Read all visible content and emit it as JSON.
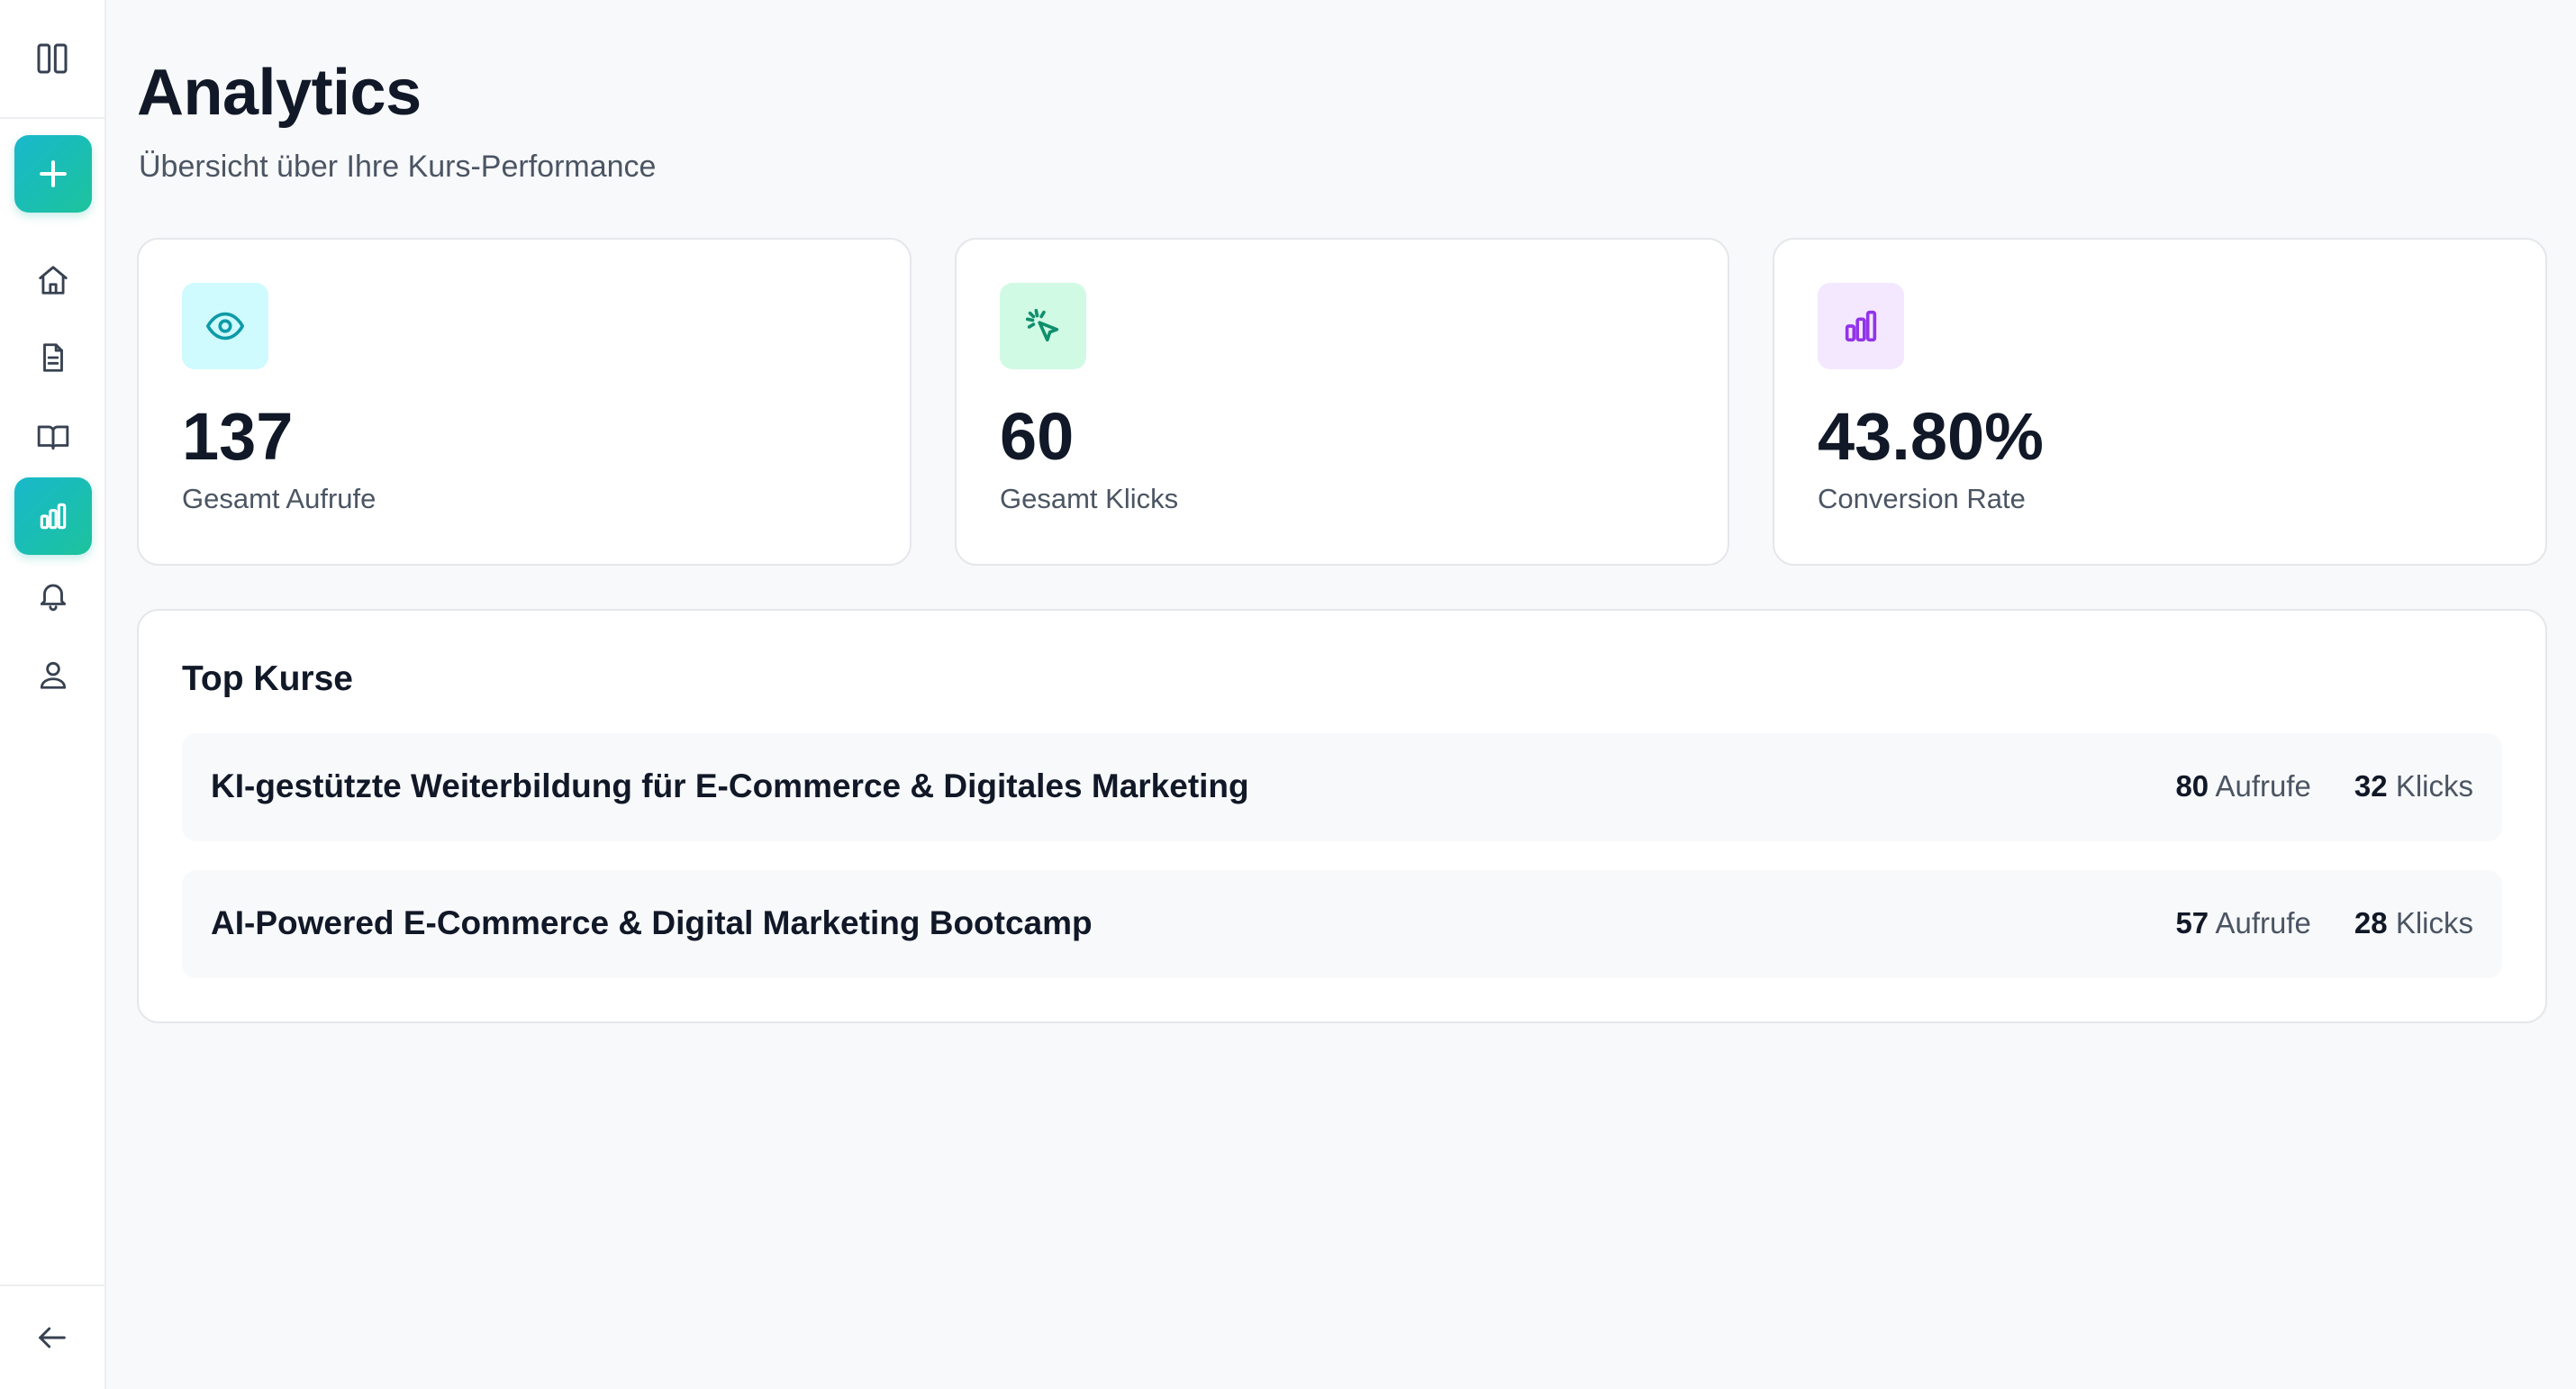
{
  "page": {
    "title": "Analytics",
    "subtitle": "Übersicht über Ihre Kurs-Performance"
  },
  "sidebar": {
    "top_icon": "panel-columns-icon",
    "items": [
      {
        "icon": "plus-icon",
        "active": true
      },
      {
        "icon": "home-icon",
        "active": false
      },
      {
        "icon": "document-icon",
        "active": false
      },
      {
        "icon": "book-icon",
        "active": false
      },
      {
        "icon": "bar-chart-icon",
        "active": true
      },
      {
        "icon": "bell-icon",
        "active": false
      },
      {
        "icon": "user-icon",
        "active": false
      }
    ],
    "bottom_icon": "arrow-left-icon"
  },
  "stats": [
    {
      "icon": "eye-icon",
      "value": "137",
      "label": "Gesamt Aufrufe",
      "icon_bg": "#cffafe",
      "icon_color": "#0e9aa7"
    },
    {
      "icon": "cursor-click-icon",
      "value": "60",
      "label": "Gesamt Klicks",
      "icon_bg": "#d1fae5",
      "icon_color": "#0f8f6e"
    },
    {
      "icon": "bar-chart-icon",
      "value": "43.80%",
      "label": "Conversion Rate",
      "icon_bg": "#f3e8ff",
      "icon_color": "#9333ea"
    }
  ],
  "top_courses": {
    "title": "Top Kurse",
    "views_suffix": "Aufrufe",
    "clicks_suffix": "Klicks",
    "items": [
      {
        "name": "KI-gestützte Weiterbildung für E-Commerce & Digitales Marketing",
        "views": "80",
        "clicks": "32"
      },
      {
        "name": "AI-Powered E-Commerce & Digital Marketing Bootcamp",
        "views": "57",
        "clicks": "28"
      }
    ]
  },
  "colors": {
    "accent_start": "#19b8cc",
    "accent_end": "#1cc39c",
    "text_primary": "#111827",
    "text_secondary": "#4b5563",
    "background": "#f8f9fb"
  }
}
